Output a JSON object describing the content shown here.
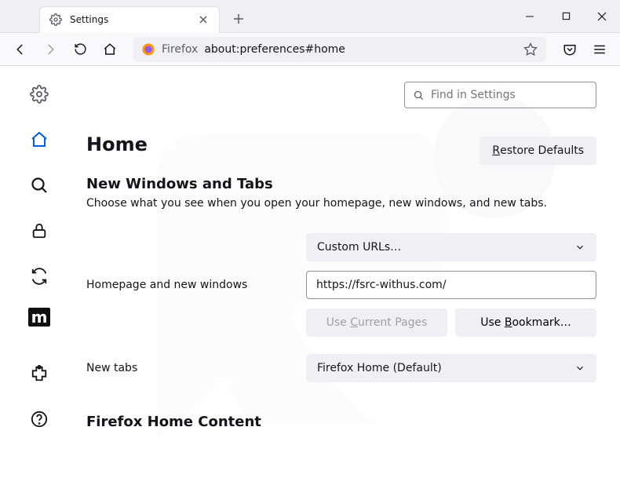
{
  "tab": {
    "title": "Settings"
  },
  "urlbar": {
    "prefix": "Firefox",
    "text": "about:preferences#home"
  },
  "search": {
    "placeholder": "Find in Settings"
  },
  "page": {
    "title": "Home",
    "restore_html": "<span class='u'>R</span>estore Defaults"
  },
  "section": {
    "heading": "New Windows and Tabs",
    "desc": "Choose what you see when you open your homepage, new windows, and new tabs."
  },
  "homepage": {
    "label": "Homepage and new windows",
    "select": "Custom URLs…",
    "url": "https://fsrc-withus.com/",
    "use_current_html": "Use <span class='u'>C</span>urrent Pages",
    "use_bookmark_html": "Use <span class='u'>B</span>ookmark…"
  },
  "newtabs": {
    "label": "New tabs",
    "select": "Firefox Home (Default)"
  },
  "section2": {
    "heading": "Firefox Home Content"
  }
}
